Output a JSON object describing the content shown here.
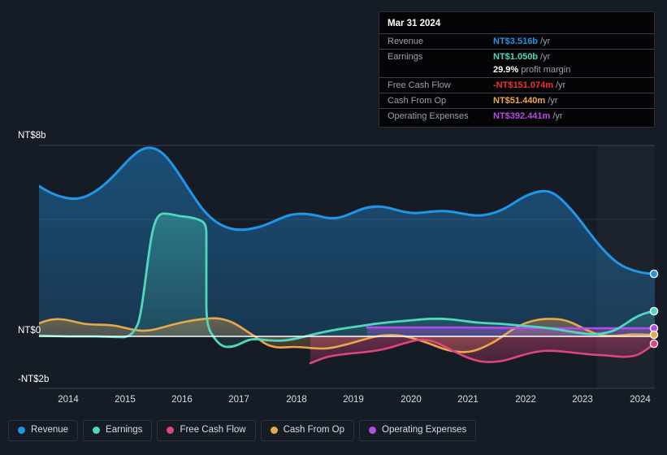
{
  "tooltip": {
    "title": "Mar 31 2024",
    "rows": [
      {
        "key": "Revenue",
        "value": "NT$3.516b",
        "unit": "/yr",
        "color": "#2196e8"
      },
      {
        "key": "Earnings",
        "value": "NT$1.050b",
        "unit": "/yr",
        "color": "#4fd8bd"
      },
      {
        "key": "",
        "value": "29.9%",
        "unit": "profit margin",
        "color": "#ffffff"
      },
      {
        "key": "Free Cash Flow",
        "value": "-NT$151.074m",
        "unit": "/yr",
        "color": "#f0312f"
      },
      {
        "key": "Cash From Op",
        "value": "NT$51.440m",
        "unit": "/yr",
        "color": "#eaa84c"
      },
      {
        "key": "Operating Expenses",
        "value": "NT$392.441m",
        "unit": "/yr",
        "color": "#b44ce8"
      }
    ]
  },
  "legend": {
    "items": [
      {
        "label": "Revenue",
        "color": "#2196e8"
      },
      {
        "label": "Earnings",
        "color": "#4fd8bd"
      },
      {
        "label": "Free Cash Flow",
        "color": "#e0457b"
      },
      {
        "label": "Cash From Op",
        "color": "#eaa84c"
      },
      {
        "label": "Operating Expenses",
        "color": "#b44ce8"
      }
    ]
  },
  "axis": {
    "y_top_label": "NT$8b",
    "y_zero_label": "NT$0",
    "y_bottom_label": "-NT$2b",
    "x_labels": [
      "2014",
      "2015",
      "2016",
      "2017",
      "2018",
      "2019",
      "2020",
      "2021",
      "2022",
      "2023",
      "2024"
    ]
  },
  "chart_data": {
    "type": "area",
    "title": "",
    "xlabel": "",
    "ylabel": "NT$",
    "ylim": [
      -2,
      8
    ],
    "xlim": [
      2013.55,
      2024.3
    ],
    "yticks": [
      8,
      0,
      -2
    ],
    "ytick_labels": [
      "NT$8b",
      "NT$0",
      "-NT$2b"
    ],
    "grid": true,
    "legend_position": "bottom",
    "currency": "NT$",
    "units": "billions",
    "forecast_region": [
      2023.05,
      2024.3
    ],
    "categories": [
      2013.55,
      2013.9,
      2014.2,
      2014.5,
      2014.8,
      2015.1,
      2015.35,
      2015.6,
      2015.9,
      2016.2,
      2016.45,
      2016.7,
      2017.0,
      2017.3,
      2017.6,
      2017.9,
      2018.2,
      2018.5,
      2018.8,
      2019.1,
      2019.4,
      2019.7,
      2020.0,
      2020.3,
      2020.6,
      2020.9,
      2021.2,
      2021.5,
      2021.8,
      2022.1,
      2022.35,
      2022.6,
      2022.9,
      2023.2,
      2023.5,
      2023.8,
      2024.05,
      2024.3
    ],
    "series": [
      {
        "name": "Revenue",
        "color": "#2196e8",
        "values": [
          6.3,
          6.05,
          5.95,
          6.25,
          6.7,
          7.25,
          7.65,
          7.55,
          7.05,
          6.2,
          5.55,
          5.2,
          5.05,
          5.05,
          5.25,
          5.4,
          5.35,
          5.3,
          5.45,
          5.55,
          5.5,
          5.35,
          5.4,
          5.4,
          5.3,
          5.25,
          5.25,
          5.3,
          5.55,
          5.85,
          5.95,
          5.7,
          5.2,
          4.65,
          4.15,
          3.8,
          3.6,
          3.52
        ],
        "end_value": 3.516,
        "end_label": "NT$3.516b"
      },
      {
        "name": "Earnings",
        "color": "#4fd8bd",
        "values": [
          0.02,
          0.0,
          0.02,
          0.0,
          -0.02,
          0.05,
          3.2,
          4.1,
          4.0,
          3.85,
          3.3,
          0.3,
          -0.45,
          -0.3,
          -0.25,
          -0.2,
          -0.22,
          -0.15,
          -0.1,
          0.05,
          0.15,
          0.22,
          0.28,
          0.32,
          0.38,
          0.42,
          0.5,
          0.58,
          0.62,
          0.6,
          0.55,
          0.52,
          0.5,
          0.45,
          0.35,
          0.25,
          0.75,
          1.05
        ],
        "end_value": 1.05,
        "end_label": "NT$1.050b"
      },
      {
        "name": "Free Cash Flow",
        "color": "#e0457b",
        "values": [
          null,
          null,
          null,
          null,
          null,
          null,
          null,
          null,
          null,
          null,
          null,
          null,
          null,
          null,
          null,
          -1.12,
          -0.95,
          -0.8,
          -0.75,
          -0.7,
          -0.55,
          -0.35,
          -0.18,
          -0.22,
          -0.35,
          -0.5,
          -0.62,
          -0.78,
          -0.85,
          -0.72,
          -0.55,
          -0.4,
          -0.28,
          -0.25,
          -0.3,
          -0.32,
          -0.25,
          -0.15
        ],
        "end_value": -0.151,
        "end_label": "-NT$151.074m"
      },
      {
        "name": "Cash From Op",
        "color": "#eaa84c",
        "values": [
          0.55,
          0.7,
          0.62,
          0.55,
          0.58,
          0.48,
          0.35,
          0.28,
          0.3,
          0.45,
          0.55,
          0.7,
          0.62,
          0.35,
          0.05,
          -0.38,
          -0.42,
          -0.5,
          -0.55,
          -0.48,
          -0.3,
          -0.12,
          0.05,
          0.0,
          -0.15,
          -0.35,
          -0.48,
          -0.6,
          -0.52,
          -0.3,
          0.1,
          0.45,
          0.6,
          0.58,
          0.35,
          0.05,
          0.02,
          0.05
        ],
        "end_value": 0.0514,
        "end_label": "NT$51.440m"
      },
      {
        "name": "Operating Expenses",
        "color": "#b44ce8",
        "values": [
          null,
          null,
          null,
          null,
          null,
          null,
          null,
          null,
          null,
          null,
          null,
          null,
          null,
          null,
          null,
          null,
          null,
          null,
          null,
          0.38,
          0.4,
          0.4,
          0.4,
          0.4,
          0.4,
          0.4,
          0.4,
          0.4,
          0.4,
          0.4,
          0.4,
          0.4,
          0.4,
          0.4,
          0.4,
          0.4,
          0.39,
          0.39
        ],
        "end_value": 0.392,
        "end_label": "NT$392.441m"
      }
    ],
    "annotations": [
      {
        "text": "29.9% profit margin",
        "at": "Mar 31 2024"
      }
    ]
  }
}
